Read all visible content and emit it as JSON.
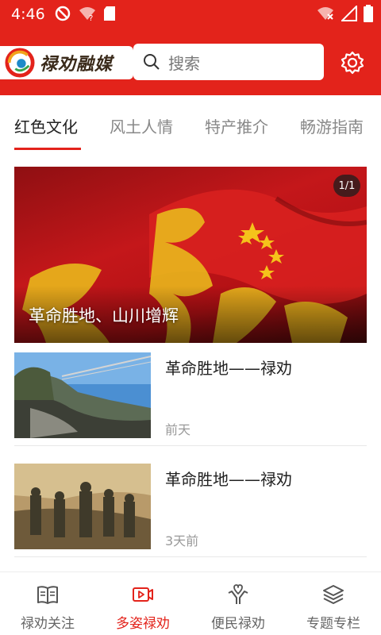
{
  "status_bar": {
    "time": "4:46",
    "icons_left": [
      "do-not-disturb-icon",
      "wifi-question-icon",
      "sd-card-icon"
    ],
    "icons_right": [
      "wifi-off-icon",
      "signal-icon",
      "battery-icon"
    ]
  },
  "header": {
    "logo_text": "禄劝融媒",
    "search_placeholder": "搜索",
    "brand_color": "#e3231b"
  },
  "tabs": [
    {
      "label": "红色文化",
      "active": true
    },
    {
      "label": "风土人情",
      "active": false
    },
    {
      "label": "特产推介",
      "active": false
    },
    {
      "label": "畅游指南",
      "active": false
    }
  ],
  "banner": {
    "caption": "革命胜地、山川增辉",
    "counter": "1/1"
  },
  "news": [
    {
      "title": "革命胜地——禄劝",
      "time": "前天"
    },
    {
      "title": "革命胜地——禄劝",
      "time": "3天前"
    }
  ],
  "bottom_nav": [
    {
      "label": "禄劝关注",
      "icon": "book-icon",
      "active": false
    },
    {
      "label": "多姿禄劝",
      "icon": "video-icon",
      "active": true
    },
    {
      "label": "便民禄劝",
      "icon": "hands-heart-icon",
      "active": false
    },
    {
      "label": "专题专栏",
      "icon": "layers-icon",
      "active": false
    }
  ]
}
